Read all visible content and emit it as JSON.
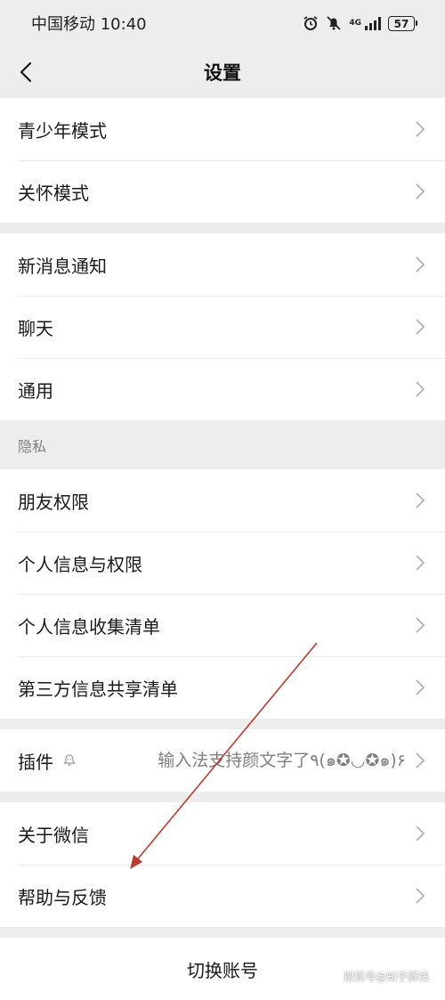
{
  "status_bar": {
    "carrier_time": "中国移动 10:40",
    "network": "4G",
    "battery": "57",
    "icons": [
      "alarm-icon",
      "mute-icon",
      "signal-icon",
      "battery-icon"
    ]
  },
  "nav": {
    "title": "设置",
    "back_icon": "chevron-left-icon"
  },
  "groups": {
    "g1": {
      "items": [
        {
          "label": "青少年模式"
        },
        {
          "label": "关怀模式"
        }
      ]
    },
    "g2": {
      "items": [
        {
          "label": "新消息通知"
        },
        {
          "label": "聊天"
        },
        {
          "label": "通用"
        }
      ]
    },
    "privacy": {
      "header": "隐私",
      "items": [
        {
          "label": "朋友权限"
        },
        {
          "label": "个人信息与权限"
        },
        {
          "label": "个人信息收集清单"
        },
        {
          "label": "第三方信息共享清单"
        }
      ]
    },
    "plugins": {
      "label": "插件",
      "value": "输入法支持颜文字了٩(๑✪◡✪๑)۶"
    },
    "g4": {
      "items": [
        {
          "label": "关于微信"
        },
        {
          "label": "帮助与反馈"
        }
      ]
    }
  },
  "switch_account": "切换账号",
  "watermark": "搜狐号@知乎驿栈",
  "colors": {
    "background": "#ededed",
    "card": "#ffffff",
    "annotation_arrow": "#c0392b"
  }
}
